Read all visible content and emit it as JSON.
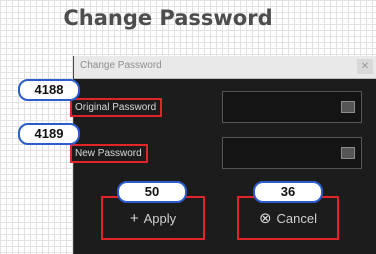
{
  "page": {
    "title": "Change Password"
  },
  "dialog": {
    "title": "Change Password",
    "close_icon": "close-icon",
    "fields": [
      {
        "label": "Original Password",
        "icon": "keyboard-icon"
      },
      {
        "label": "New Password",
        "icon": "keyboard-icon"
      }
    ],
    "buttons": {
      "apply": {
        "label": "Apply",
        "glyph": "+"
      },
      "cancel": {
        "label": "Cancel",
        "glyph": "⊗"
      }
    }
  },
  "annotations": {
    "original_password": "4188",
    "new_password": "4189",
    "apply": "50",
    "cancel": "36"
  },
  "colors": {
    "highlight_border": "#e0242c",
    "badge_border": "#2a5dc9",
    "dialog_background": "#1c1c1c"
  }
}
